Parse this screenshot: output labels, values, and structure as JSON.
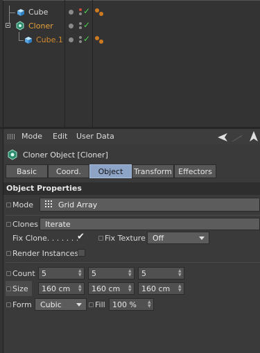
{
  "object_manager": {
    "rows": [
      {
        "label": "Cube",
        "color": "#d8d8d8",
        "icon": "cube-icon"
      },
      {
        "label": "Cloner",
        "color": "#e8a23a",
        "icon": "cloner-icon"
      },
      {
        "label": "Cube.1",
        "color": "#d28a2c",
        "icon": "cube-icon"
      }
    ],
    "check_glyph": "✓"
  },
  "attributes": {
    "menu": [
      "Mode",
      "Edit",
      "User Data"
    ],
    "object_title": "Cloner Object [Cloner]",
    "tabs": [
      {
        "label": "Basic",
        "active": false
      },
      {
        "label": "Coord.",
        "active": false
      },
      {
        "label": "Object",
        "active": true
      },
      {
        "label": "Transform",
        "active": false
      },
      {
        "label": "Effectors",
        "active": false
      }
    ],
    "section_title": "Object Properties",
    "mode": {
      "label": "Mode",
      "value": "Grid Array"
    },
    "clones": {
      "label": "Clones",
      "value": "Iterate"
    },
    "fix_clone": {
      "label": "Fix Clone. . . . . . .",
      "checked": true,
      "check_glyph": "✔"
    },
    "fix_texture": {
      "label": "Fix Texture",
      "value": "Off"
    },
    "render_instances": {
      "label": "Render Instances",
      "checked": false
    },
    "count": {
      "label": "Count",
      "values": [
        "5",
        "5",
        "5"
      ]
    },
    "size": {
      "label": "Size",
      "values": [
        "160 cm",
        "160 cm",
        "160 cm"
      ]
    },
    "form": {
      "label": "Form",
      "value": "Cubic"
    },
    "fill": {
      "label": "Fill",
      "value": "100 %"
    }
  },
  "colors": {
    "active_tab": "#8ea4c6",
    "cloner_label": "#e8a23a",
    "check_green": "#4fd150",
    "tag_orange": "#d07a20"
  }
}
